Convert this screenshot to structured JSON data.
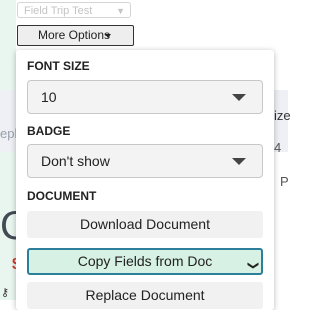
{
  "background": {
    "top_select_value": "Field Trip Test",
    "more_options_label": "More Options",
    "fragment_left": "epl",
    "fragment_right_1": "ize",
    "fragment_right_2": "4",
    "fragment_right_3": "P",
    "big_glyph": "C",
    "red_glyph": "$",
    "small_icon": "⚷"
  },
  "panel": {
    "font_size": {
      "title": "FONT SIZE",
      "value": "10"
    },
    "badge": {
      "title": "BADGE",
      "value": "Don't show"
    },
    "document": {
      "title": "DOCUMENT",
      "download_label": "Download Document",
      "copy_fields_label": "Copy Fields from Doc",
      "replace_label": "Replace Document"
    }
  },
  "colors": {
    "active_button_bg": "#d7f1e4",
    "active_button_border": "#2b7f9a"
  }
}
